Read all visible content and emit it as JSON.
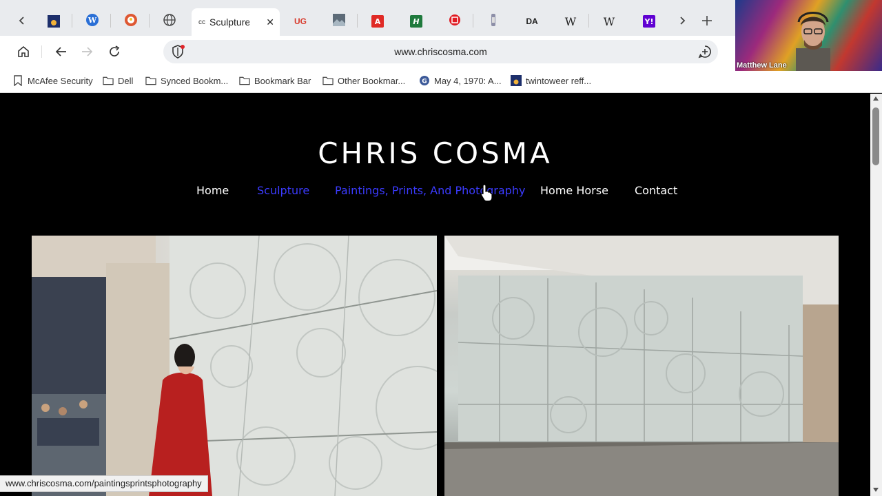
{
  "browser": {
    "tabs": [
      {
        "kind": "favicon",
        "icon": "blue-sunset-icon"
      },
      {
        "kind": "favicon",
        "icon": "wordpress-icon"
      },
      {
        "kind": "favicon",
        "icon": "duckduckgo-icon"
      },
      {
        "kind": "favicon",
        "icon": "globe-icon"
      },
      {
        "kind": "favicon",
        "label": "UG"
      },
      {
        "kind": "favicon",
        "icon": "image-icon"
      },
      {
        "kind": "favicon",
        "label": "A"
      },
      {
        "kind": "favicon",
        "label": "H"
      },
      {
        "kind": "favicon",
        "icon": "red-circle-icon"
      },
      {
        "kind": "favicon",
        "icon": "bottle-icon"
      },
      {
        "kind": "favicon",
        "label": "DA"
      },
      {
        "kind": "favicon",
        "label": "W"
      },
      {
        "kind": "favicon",
        "label": "W"
      },
      {
        "kind": "favicon",
        "label": "Y!"
      }
    ],
    "active_tab": {
      "title": "Sculpture",
      "favicon_text": "cc"
    },
    "url": "www.chriscosma.com",
    "bookmarks": [
      {
        "label": "McAfee Security",
        "icon": "bookmark-icon"
      },
      {
        "label": "Dell",
        "icon": "folder-icon"
      },
      {
        "label": "Synced Bookm...",
        "icon": "folder-icon"
      },
      {
        "label": "Bookmark Bar",
        "icon": "folder-icon"
      },
      {
        "label": "Other Bookmar...",
        "icon": "folder-icon"
      },
      {
        "label": "May 4, 1970: A...",
        "icon": "history-icon"
      },
      {
        "label": "twintoweer reff...",
        "icon": "blue-sunset-icon"
      }
    ],
    "status_url": "www.chriscosma.com/paintingsprintsphotography"
  },
  "webcam": {
    "name": "Matthew Lane"
  },
  "site": {
    "title": "CHRIS COSMA",
    "nav": [
      {
        "label": "Home",
        "state": "normal"
      },
      {
        "label": "Sculpture",
        "state": "active"
      },
      {
        "label": "Paintings, Prints, And Photography",
        "state": "hover"
      },
      {
        "label": "Home Horse",
        "state": "normal"
      },
      {
        "label": "Contact",
        "state": "normal"
      }
    ]
  },
  "colors": {
    "nav_active": "#3b3bff",
    "nav_normal": "#ffffff",
    "page_bg": "#000000"
  }
}
